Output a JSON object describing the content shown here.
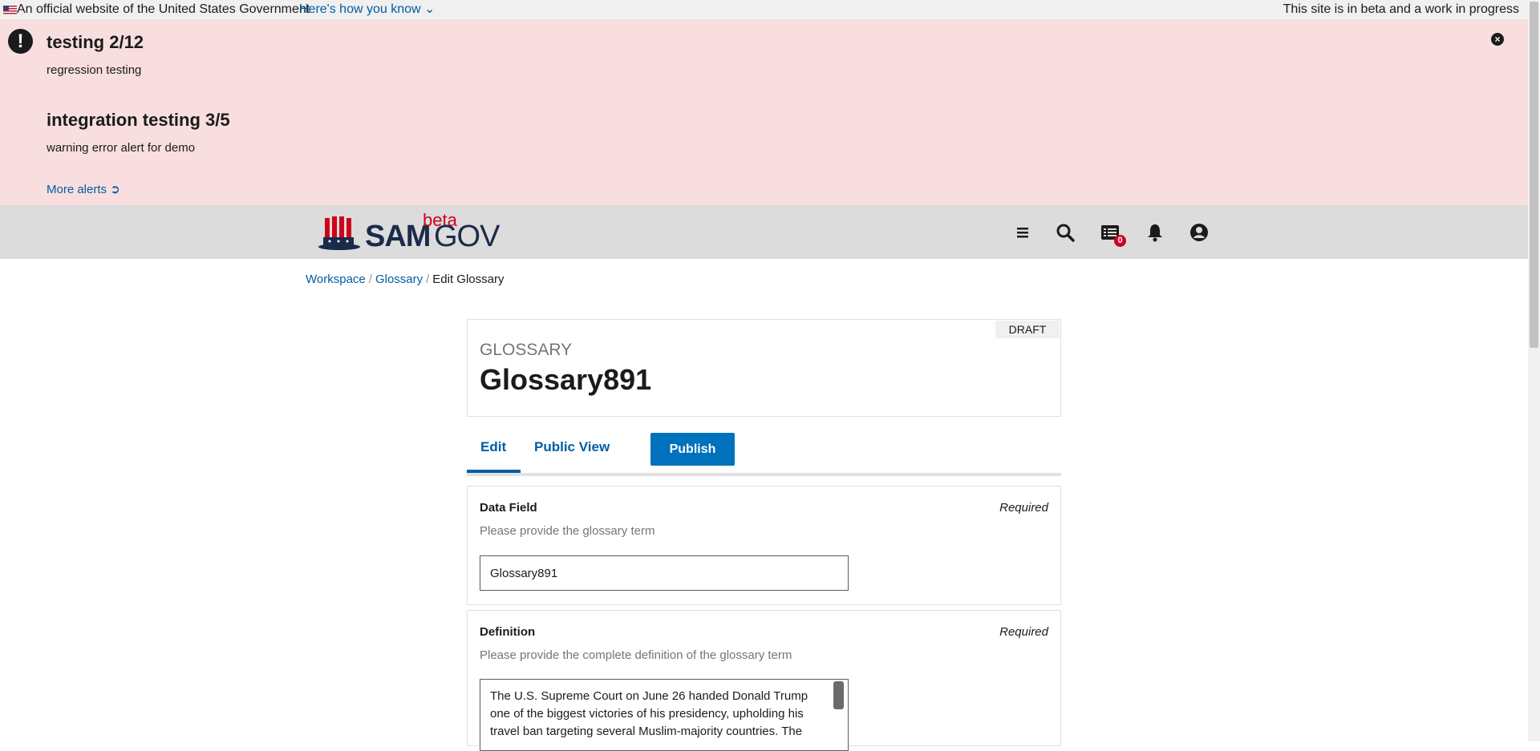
{
  "gov_banner": {
    "official_text": "An official website of the United States Government",
    "how_you_know": "Here's how you know",
    "beta_text": "This site is in beta and a work in progress"
  },
  "alerts": {
    "items": [
      {
        "title": "testing 2/12",
        "description": "regression testing"
      },
      {
        "title": "integration testing 3/5",
        "description": "warning error alert for demo"
      }
    ],
    "more_link": "More alerts"
  },
  "header": {
    "logo": {
      "sam": "SAM",
      "gov": "GOV",
      "beta": "beta"
    },
    "icons": [
      "menu-icon",
      "search-icon",
      "messages-icon",
      "bell-icon",
      "user-icon"
    ],
    "messages_count": "0",
    "accent_color": "#005ea2"
  },
  "breadcrumb": {
    "items": [
      "Workspace",
      "Glossary"
    ],
    "current": "Edit Glossary"
  },
  "card": {
    "status": "DRAFT",
    "type": "GLOSSARY",
    "name": "Glossary891"
  },
  "tabs": {
    "edit": "Edit",
    "public_view": "Public View",
    "publish": "Publish"
  },
  "fields": {
    "data_field": {
      "label": "Data Field",
      "required": "Required",
      "help": "Please provide the glossary term",
      "value": "Glossary891"
    },
    "definition": {
      "label": "Definition",
      "required": "Required",
      "help": "Please provide the complete definition of the glossary term",
      "value": "The U.S. Supreme Court on June 26 handed Donald Trump one of the biggest victories of his presidency, upholding his travel ban targeting several Muslim-majority countries. The"
    }
  }
}
